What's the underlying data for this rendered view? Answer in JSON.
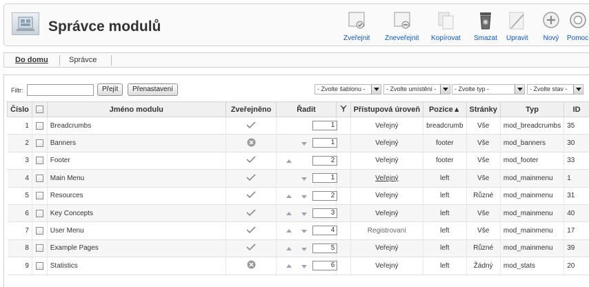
{
  "header": {
    "title": "Správce modulů",
    "toolbar": [
      {
        "name": "publish",
        "label": "Zveřejnit",
        "icon": "publish-icon"
      },
      {
        "name": "unpublish",
        "label": "Zneveřejnit",
        "icon": "unpublish-icon"
      },
      {
        "name": "copy",
        "label": "Kopírovat",
        "icon": "copy-icon"
      },
      {
        "name": "delete",
        "label": "Smazat",
        "icon": "trash-icon"
      },
      {
        "name": "edit",
        "label": "Upravit",
        "icon": "edit-icon"
      },
      {
        "name": "new",
        "label": "Nový",
        "icon": "plus-icon"
      },
      {
        "name": "help",
        "label": "Pomoc",
        "icon": "help-icon"
      }
    ]
  },
  "submenu": {
    "items": [
      "Do domu",
      "Správce"
    ],
    "active": "Do domu"
  },
  "filter": {
    "label": "Filtr:",
    "value": "",
    "go_label": "Přejít",
    "reset_label": "Přenastavení",
    "selects": [
      "- Zvolte šablonu -",
      "- Zvolte umístění -",
      "- Zvolte typ -",
      "- Zvolte stav -"
    ]
  },
  "table": {
    "columns": [
      "Číslo",
      "",
      "Jméno modulu",
      "Zveřejněno",
      "Řadit",
      "",
      "Přístupová úroveň",
      "Pozice▲",
      "Stránky",
      "Typ",
      "ID"
    ],
    "rows": [
      {
        "num": "1",
        "name": "Breadcrumbs",
        "published": true,
        "up": false,
        "down": false,
        "order": "1",
        "access": "Veřejný",
        "access_link": false,
        "position": "breadcrumb",
        "pages": "Vše",
        "type": "mod_breadcrumbs",
        "id": "35"
      },
      {
        "num": "2",
        "name": "Banners",
        "published": false,
        "up": false,
        "down": true,
        "order": "1",
        "access": "Veřejný",
        "access_link": false,
        "position": "footer",
        "pages": "Vše",
        "type": "mod_banners",
        "id": "30"
      },
      {
        "num": "3",
        "name": "Footer",
        "published": true,
        "up": true,
        "down": false,
        "order": "2",
        "access": "Veřejný",
        "access_link": false,
        "position": "footer",
        "pages": "Vše",
        "type": "mod_footer",
        "id": "33"
      },
      {
        "num": "4",
        "name": "Main Menu",
        "published": true,
        "up": false,
        "down": true,
        "order": "1",
        "access": "Veřejný",
        "access_link": true,
        "position": "left",
        "pages": "Vše",
        "type": "mod_mainmenu",
        "id": "1"
      },
      {
        "num": "5",
        "name": "Resources",
        "published": true,
        "up": true,
        "down": true,
        "order": "2",
        "access": "Veřejný",
        "access_link": false,
        "position": "left",
        "pages": "Různé",
        "type": "mod_mainmenu",
        "id": "31"
      },
      {
        "num": "6",
        "name": "Key Concepts",
        "published": true,
        "up": true,
        "down": true,
        "order": "3",
        "access": "Veřejný",
        "access_link": false,
        "position": "left",
        "pages": "Vše",
        "type": "mod_mainmenu",
        "id": "40"
      },
      {
        "num": "7",
        "name": "User Menu",
        "published": true,
        "up": true,
        "down": true,
        "order": "4",
        "access": "Registrovaní",
        "access_link": false,
        "position": "left",
        "pages": "Vše",
        "type": "mod_mainmenu",
        "id": "17"
      },
      {
        "num": "8",
        "name": "Example Pages",
        "published": true,
        "up": true,
        "down": true,
        "order": "5",
        "access": "Veřejný",
        "access_link": false,
        "position": "left",
        "pages": "Různé",
        "type": "mod_mainmenu",
        "id": "39"
      },
      {
        "num": "9",
        "name": "Statistics",
        "published": false,
        "up": true,
        "down": true,
        "order": "6",
        "access": "Veřejný",
        "access_link": false,
        "position": "left",
        "pages": "Žádný",
        "type": "mod_stats",
        "id": "20"
      }
    ]
  }
}
